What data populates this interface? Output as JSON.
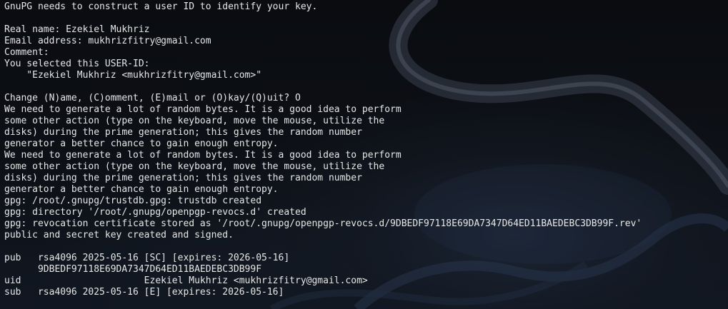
{
  "terminal": {
    "lines": [
      "GnuPG needs to construct a user ID to identify your key.",
      "",
      "Real name: Ezekiel Mukhriz",
      "Email address: mukhrizfitry@gmail.com",
      "Comment: ",
      "You selected this USER-ID:",
      "    \"Ezekiel Mukhriz <mukhrizfitry@gmail.com>\"",
      "",
      "Change (N)ame, (C)omment, (E)mail or (O)kay/(Q)uit? O",
      "We need to generate a lot of random bytes. It is a good idea to perform",
      "some other action (type on the keyboard, move the mouse, utilize the",
      "disks) during the prime generation; this gives the random number",
      "generator a better chance to gain enough entropy.",
      "We need to generate a lot of random bytes. It is a good idea to perform",
      "some other action (type on the keyboard, move the mouse, utilize the",
      "disks) during the prime generation; this gives the random number",
      "generator a better chance to gain enough entropy.",
      "gpg: /root/.gnupg/trustdb.gpg: trustdb created",
      "gpg: directory '/root/.gnupg/openpgp-revocs.d' created",
      "gpg: revocation certificate stored as '/root/.gnupg/openpgp-revocs.d/9DBEDF97118E69DA7347D64ED11BAEDEBC3DB99F.rev'",
      "public and secret key created and signed.",
      "",
      "pub   rsa4096 2025-05-16 [SC] [expires: 2026-05-16]",
      "      9DBEDF97118E69DA7347D64ED11BAEDEBC3DB99F",
      "uid                      Ezekiel Mukhriz <mukhrizfitry@gmail.com>",
      "sub   rsa4096 2025-05-16 [E] [expires: 2026-05-16]"
    ]
  },
  "theme": {
    "background": "#0b0d12",
    "foreground": "#e6e6e6"
  }
}
